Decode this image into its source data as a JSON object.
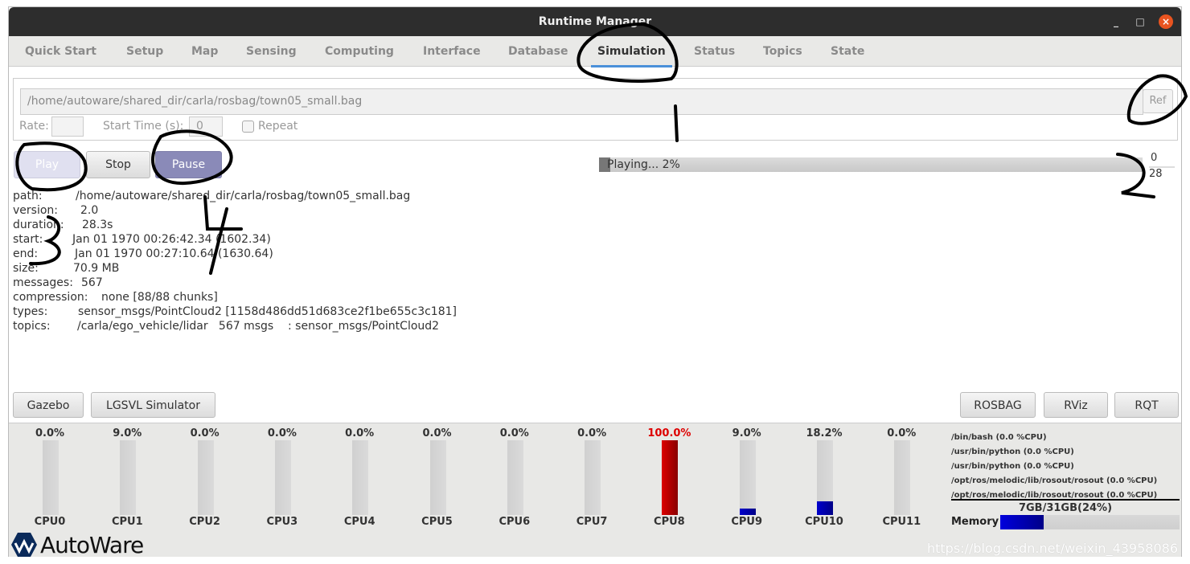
{
  "window": {
    "title": "Runtime Manager",
    "minimize": "_",
    "maximize": "□",
    "close": "×"
  },
  "tabs": [
    "Quick Start",
    "Setup",
    "Map",
    "Sensing",
    "Computing",
    "Interface",
    "Database",
    "Simulation",
    "Status",
    "Topics",
    "State"
  ],
  "active_tab": "Simulation",
  "rosbag": {
    "path": "/home/autoware/shared_dir/carla/rosbag/town05_small.bag",
    "ref_label": "Ref",
    "rate_label": "Rate:",
    "rate_value": "",
    "start_time_label": "Start Time (s):",
    "start_time_value": "0",
    "repeat_label": "Repeat",
    "repeat_checked": false
  },
  "controls": {
    "play": "Play",
    "stop": "Stop",
    "pause": "Pause"
  },
  "progress": {
    "text": "Playing...  2%",
    "percent": 2,
    "current": "0",
    "total": "28"
  },
  "info": [
    {
      "key": "path:",
      "value": "/home/autoware/shared_dir/carla/rosbag/town05_small.bag"
    },
    {
      "key": "version:",
      "value": "2.0"
    },
    {
      "key": "duration:",
      "value": "28.3s"
    },
    {
      "key": "start:",
      "value": "Jan 01 1970 00:26:42.34 (1602.34)"
    },
    {
      "key": "end:",
      "value": "Jan 01 1970 00:27:10.64 (1630.64)"
    },
    {
      "key": "size:",
      "value": "70.9 MB"
    },
    {
      "key": "messages:",
      "value": "567"
    },
    {
      "key": "compression:",
      "value": "none [88/88 chunks]"
    },
    {
      "key": "types:",
      "value": "sensor_msgs/PointCloud2 [1158d486dd51d683ce2f1be655c3c181]"
    },
    {
      "key": "topics:",
      "value": "/carla/ego_vehicle/lidar   567 msgs    : sensor_msgs/PointCloud2"
    }
  ],
  "sim_buttons": {
    "gazebo": "Gazebo",
    "lgsvl": "LGSVL Simulator",
    "rosbag": "ROSBAG",
    "rviz": "RViz",
    "rqt": "RQT"
  },
  "cpus": [
    {
      "name": "CPU0",
      "pct": "0.0%",
      "value": 0
    },
    {
      "name": "CPU1",
      "pct": "9.0%",
      "value": 0
    },
    {
      "name": "CPU2",
      "pct": "0.0%",
      "value": 0
    },
    {
      "name": "CPU3",
      "pct": "0.0%",
      "value": 0
    },
    {
      "name": "CPU4",
      "pct": "0.0%",
      "value": 0
    },
    {
      "name": "CPU5",
      "pct": "0.0%",
      "value": 0
    },
    {
      "name": "CPU6",
      "pct": "0.0%",
      "value": 0
    },
    {
      "name": "CPU7",
      "pct": "0.0%",
      "value": 0
    },
    {
      "name": "CPU8",
      "pct": "100.0%",
      "value": 100
    },
    {
      "name": "CPU9",
      "pct": "9.0%",
      "value": 9
    },
    {
      "name": "CPU10",
      "pct": "18.2%",
      "value": 18
    },
    {
      "name": "CPU11",
      "pct": "0.0%",
      "value": 0
    }
  ],
  "colors": {
    "cpu_high": "#dd0000",
    "cpu_normal": "#0000cc",
    "accent": "#4a90d9"
  },
  "processes": [
    "/bin/bash (0.0 %CPU)",
    "/usr/bin/python (0.0 %CPU)",
    "/usr/bin/python (0.0 %CPU)",
    "/opt/ros/melodic/lib/rosout/rosout (0.0 %CPU)",
    "/opt/ros/melodic/lib/rosout/rosout (0.0 %CPU)"
  ],
  "memory": {
    "label": "Memory",
    "text": "7GB/31GB(24%)",
    "percent": 24
  },
  "logo": "AutoWare",
  "watermark": "https://blog.csdn.net/weixin_43958086"
}
